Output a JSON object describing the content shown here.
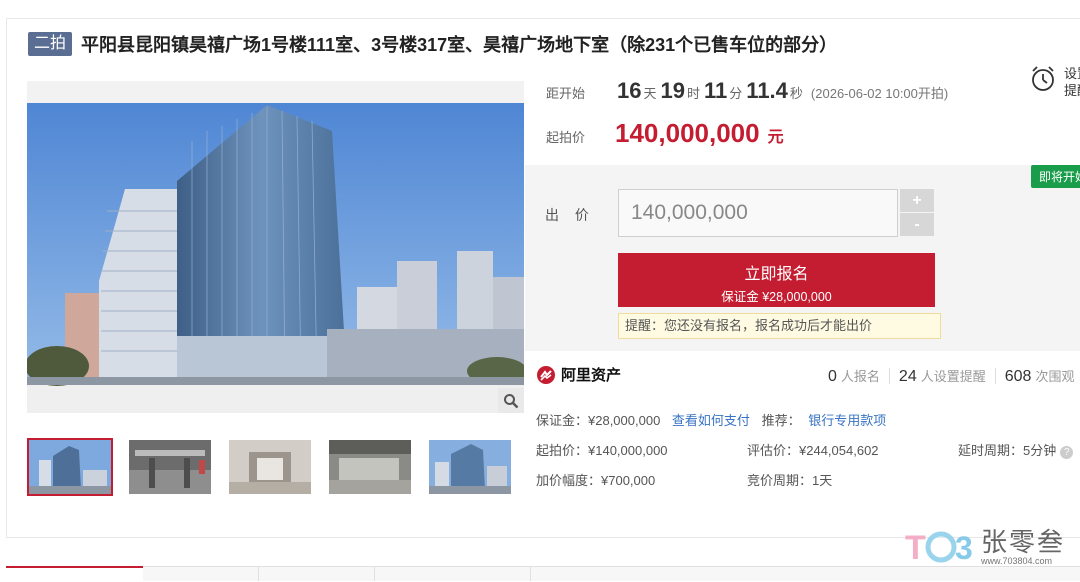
{
  "title": {
    "round": "二拍",
    "text": "平阳县昆阳镇昊禧广场1号楼111室、3号楼317室、昊禧广场地下室（除231个已售车位的部分）"
  },
  "countdown": {
    "label": "距开始",
    "days": "16",
    "days_unit": "天",
    "hours": "19",
    "hours_unit": "时",
    "minutes": "11",
    "minutes_unit": "分",
    "seconds": "11.4",
    "seconds_unit": "秒",
    "start_note": "(2026-06-02 10:00开拍)"
  },
  "remind": {
    "line1": "设置",
    "line2": "提醒",
    "icon": "alarm-clock-icon"
  },
  "start_price": {
    "label": "起拍价",
    "value": "140,000,000",
    "unit": "元"
  },
  "bid": {
    "status_badge": "即将开始",
    "label": "出 价",
    "value": "140,000,000",
    "plus": "+",
    "minus": "-",
    "signup_label": "立即报名",
    "deposit_label": "保证金 ¥28,000,000",
    "notice": "提醒：您还没有报名，报名成功后才能出价"
  },
  "stats": {
    "brand": "阿里资产",
    "signup_count": "0",
    "signup_label": "人报名",
    "reminder_count": "24",
    "reminder_label": "人设置提醒",
    "view_count": "608",
    "view_label": "次围观"
  },
  "details": {
    "deposit": "保证金：¥28,000,000",
    "how_to_pay": "查看如何支付",
    "recommend_label": "推荐：",
    "recommend_link": "银行专用款项",
    "start_price": "起拍价：¥140,000,000",
    "appraisal": "评估价：¥244,054,602",
    "delay": "延时周期：5分钟",
    "increment": "加价幅度：¥700,000",
    "cycle": "竞价周期：1天"
  },
  "watermark": {
    "name": "张零叁",
    "url": "www.703804.com"
  },
  "colors": {
    "accent": "#c41d31",
    "badge": "#5a6d92",
    "green": "#1a9d4b",
    "link": "#3873c4"
  }
}
